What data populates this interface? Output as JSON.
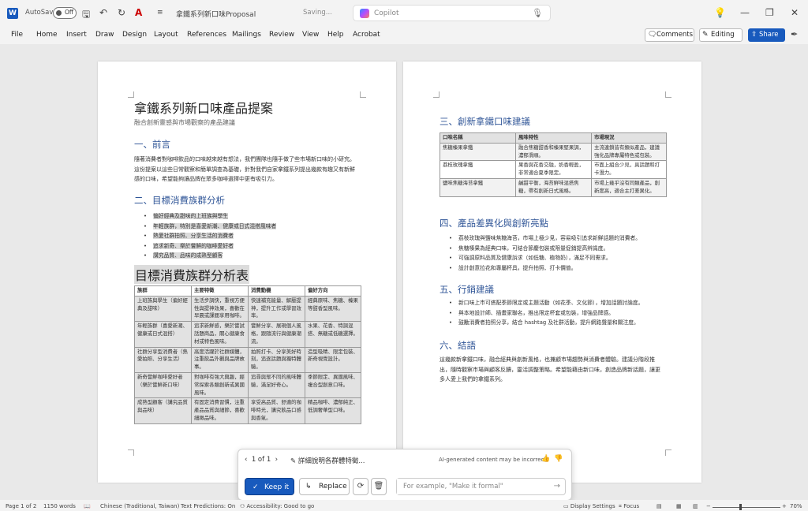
{
  "titlebar": {
    "autosave_label": "AutoSave",
    "autosave_state": "Off",
    "doc_title": "拿鐵系列新口味Proposal",
    "saving_status": "Saving...",
    "copilot_placeholder": "Copilot"
  },
  "menu": {
    "items": [
      "File",
      "Home",
      "Insert",
      "Draw",
      "Design",
      "Layout",
      "References",
      "Mailings",
      "Review",
      "View",
      "Help",
      "Acrobat"
    ],
    "comments_label": "Comments",
    "editing_label": "Editing",
    "share_label": "Share"
  },
  "page1": {
    "title": "拿鐵系列新口味產品提案",
    "subtitle": "融合創新靈感與市場觀察的產品建議",
    "h_intro": "一、前言",
    "intro_text": "隨著消費者對咖啡飲品的口味越來越有想法，我們團隊也隨手做了些市場新口味的小研究。這份提案以這些日常觀察和簡單調查為基礎，針對我們自家拿鐵系列提出幾款有趣又有新鮮感的口味，希望能夠讓品牌在眾多咖啡選擇中更有吸引力。",
    "h_segments": "二、目標消費族群分析",
    "segment_bullets": [
      "偏好經典及甜味的上班族與學生",
      "年輕族群，特別是喜愛新潮、健康或日式混搭風味者",
      "熱愛社群拍照、分享生活的消費者",
      "追求新奇、樂於嘗鮮的咖啡愛好者",
      "講究品質、品味的成熟型顧客"
    ],
    "table_heading": "目標消費族群分析表",
    "table_headers": [
      "族群",
      "主要特徵",
      "消費動機",
      "偏好方向"
    ],
    "table_rows": [
      [
        "上班族與學生（偏好經典及甜味）",
        "生活步調快，重視方便性與提神效果，喜歡在早晨或課間享用咖啡。",
        "快速補充能量、解壓提神，提升工作或學習效率。",
        "經典原味、焦糖、榛果等甜香型風味。"
      ],
      [
        "年輕族群（喜愛新潮、健康或日式混搭）",
        "追求新鮮感，樂於嘗試話題商品，關心健康食材或特色風味。",
        "嘗鮮分享、展現個人風格，跟隨流行與健康潮流。",
        "水果、花香、特調混搭、無糖或低糖選擇。"
      ],
      [
        "社群分享型消費者（熱愛拍照、分享生活）",
        "高度活躍於社群媒體，注重飲品外觀與品牌故事。",
        "拍照打卡、分享美好時刻，追逐話題與獨特體驗。",
        "造型吸睛、限定包裝、新奇視覺設計。"
      ],
      [
        "新奇嘗鮮咖啡愛好者（樂於嘗鮮新口味）",
        "對咖啡有強大興趣，經常探索各類創新或異國風味。",
        "追尋與眾不同的風味體驗，滿足好奇心。",
        "季節限定、異國風味、複合型創意口味。"
      ],
      [
        "成熟型顧客（講究品質與品味）",
        "有固定消費習慣，注重產品品質與細節，喜歡細緻品味。",
        "享受高品質、舒適的咖啡時光，講究飲品口感與香氣。",
        "精品咖啡、濃郁純正、低調奢華型口味。"
      ]
    ]
  },
  "page2": {
    "h_flavors": "三、創新拿鐵口味建議",
    "flavor_headers": [
      "口味名稱",
      "風味特性",
      "市場現況"
    ],
    "flavor_rows": [
      [
        "焦糖榛果拿鐵",
        "融合焦糖甜香和榛果堅果調，濃郁滑順。",
        "主流連鎖皆有類似產品，建議強化品牌專屬特色或包裝。"
      ],
      [
        "荔枝玫瑰拿鐵",
        "果香與花香交融，奶香輕盈，非常適合夏季限定。",
        "市面上組合少見，具話題和打卡潛力。"
      ],
      [
        "鹽味焦糖海苔拿鐵",
        "鹹甜平衡，海苔鮮味混搭焦糖，帶有創新日式風格。",
        "市場上幾乎沒有同類產品，創新度高，適合主打差異化。"
      ]
    ],
    "h_diff": "四、產品差異化與創新亮點",
    "diff_bullets": [
      "荔枝玫瑰與鹽味焦糖海苔，市場上極少見，容易吸引追求新鮮話題的消費者。",
      "焦糖榛果為經典口味，可結合節慶包裝或限量促銷提高辨識度。",
      "可強調原料品質及健康訴求（如低糖、植物奶），滿足不同需求。",
      "設計創意拉花和專屬杯具，提升拍照、打卡價值。"
    ],
    "h_marketing": "五、行銷建議",
    "marketing_bullets": [
      "新口味上市可搭配季節限定或主題活動（如花季、文化節），增加話題討論度。",
      "與本地設計師、插畫家聯名，推出限定杯套或包裝，增強品牌感。",
      "鼓勵消費者拍照分享，結合 hashtag 及社群活動，提升網路聲量和關注度。"
    ],
    "h_conclusion": "六、結語",
    "conclusion_text": "這幾款新拿鐵口味，融合經典與創新風格，也兼顧市場趨勢與消費者體驗。建議分階段推出，隨時觀察市場與顧客反饋，靈活調整策略。希望能藉由新口味，創造品牌新話題，讓更多人愛上我們的拿鐵系列。"
  },
  "copilot_panel": {
    "nav_label": "1 of 1",
    "prompt_text": "詳細說明各群體特徵...",
    "ai_note": "AI-generated content may be incorrect",
    "keep_label": "Keep it",
    "replace_label": "Replace",
    "input_placeholder": "For example, \"Make it formal\""
  },
  "statusbar": {
    "page": "Page 1 of 2",
    "words": "1150 words",
    "language": "Chinese (Traditional, Taiwan)",
    "text_predictions": "Text Predictions: On",
    "accessibility": "Accessibility: Good to go",
    "display_settings": "Display Settings",
    "focus": "Focus",
    "zoom": "70%"
  }
}
